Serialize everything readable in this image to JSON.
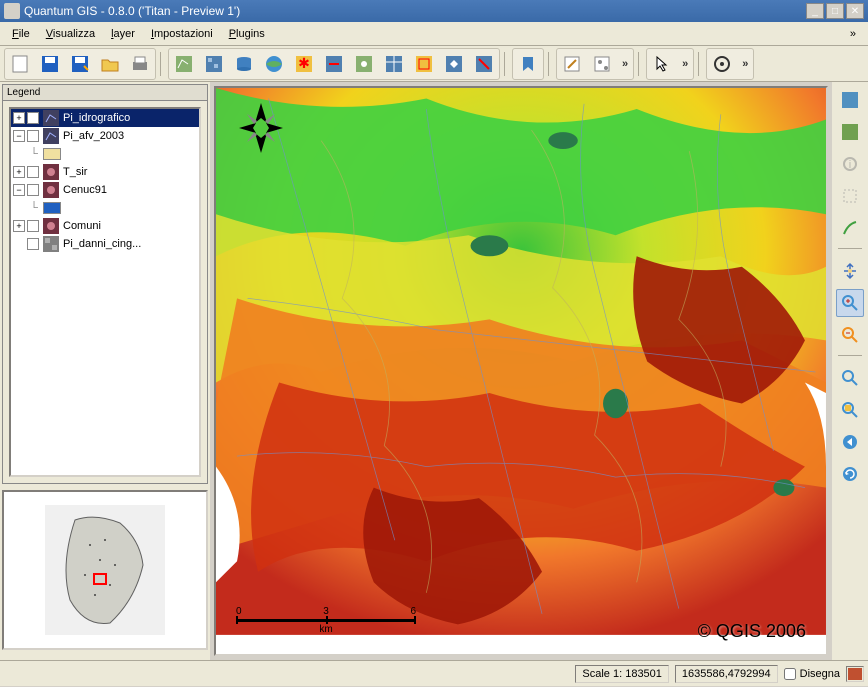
{
  "window": {
    "title": "Quantum GIS - 0.8.0 ('Titan - Preview 1')"
  },
  "menu": {
    "items": [
      {
        "label": "File",
        "mnemonic": "F"
      },
      {
        "label": "Visualizza",
        "mnemonic": "V"
      },
      {
        "label": "layer",
        "mnemonic": "l"
      },
      {
        "label": "Impostazioni",
        "mnemonic": "I"
      },
      {
        "label": "Plugins",
        "mnemonic": "P"
      }
    ]
  },
  "legend": {
    "title": "Legend",
    "layers": [
      {
        "name": "Pi_idrografico",
        "selected": true,
        "expandable": true,
        "symbol_color": "#5a5a5a",
        "icon": "layer-vector"
      },
      {
        "name": "Pi_afv_2003",
        "selected": false,
        "expandable": true,
        "symbol_color": "#c8a050",
        "icon": "layer-vector",
        "has_subsymbol": true,
        "subsymbol_color": "#f0e0a0"
      },
      {
        "name": "T_sir",
        "selected": false,
        "expandable": true,
        "symbol_color": "#904050",
        "icon": "layer-vector"
      },
      {
        "name": "Cenuc91",
        "selected": false,
        "expandable": true,
        "symbol_color": "#904050",
        "icon": "layer-vector",
        "has_subsymbol": true,
        "subsymbol_color": "#2060c0"
      },
      {
        "name": "Comuni",
        "selected": false,
        "expandable": true,
        "symbol_color": "#904050",
        "icon": "layer-vector"
      },
      {
        "name": "Pi_danni_cing...",
        "selected": false,
        "expandable": false,
        "symbol_color": "#808080",
        "icon": "layer-raster"
      }
    ]
  },
  "map": {
    "copyright": "© QGIS 2006",
    "scalebar_labels": [
      "0",
      "3",
      "6"
    ],
    "scalebar_unit": "km"
  },
  "statusbar": {
    "scale_label": "Scale 1:",
    "scale_value": "183501",
    "coords": "1635586,4792994",
    "render_label": "Disegna"
  },
  "colors": {
    "title_bg": "#4a7ab8",
    "panel_bg": "#ece9d8",
    "selection": "#0a246a"
  }
}
